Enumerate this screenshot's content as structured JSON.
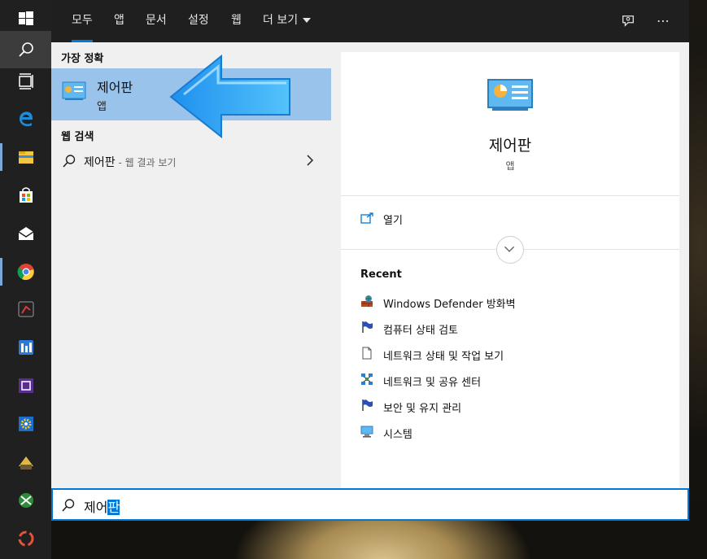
{
  "panel": {
    "tabs": [
      {
        "label": "모두",
        "active": true
      },
      {
        "label": "앱"
      },
      {
        "label": "문서"
      },
      {
        "label": "설정"
      },
      {
        "label": "웹"
      },
      {
        "label": "더 보기"
      }
    ],
    "feedback_icon": "feedback-icon",
    "more_options": "⋯"
  },
  "results": {
    "best_match_header": "가장 정확",
    "best_match": {
      "name": "제어판",
      "type": "앱",
      "icon": "control-panel-icon"
    },
    "web_header": "웹 검색",
    "web_query": "제어판",
    "web_suffix": " - 웹 결과 보기"
  },
  "detail": {
    "name": "제어판",
    "type": "앱",
    "open_label": "열기",
    "recent_header": "Recent",
    "recent": [
      {
        "label": "Windows Defender 방화벽",
        "icon": "firewall-icon"
      },
      {
        "label": "컴퓨터 상태 검토",
        "icon": "flag-icon"
      },
      {
        "label": "네트워크 상태 및 작업 보기",
        "icon": "document-icon"
      },
      {
        "label": "네트워크 및 공유 센터",
        "icon": "network-icon"
      },
      {
        "label": "보안 및 유지 관리",
        "icon": "flag-icon"
      },
      {
        "label": "시스템",
        "icon": "system-icon"
      }
    ]
  },
  "search": {
    "typed": "제어",
    "selected": "판"
  },
  "taskbar": {
    "items": [
      "windows-start-icon",
      "search-icon",
      "task-view-icon",
      "edge-icon",
      "file-explorer-icon",
      "store-icon",
      "mail-icon",
      "chrome-icon",
      "app-icon",
      "app-icon",
      "app-icon",
      "settings-icon",
      "app-icon",
      "app-icon",
      "app-icon"
    ]
  },
  "colors": {
    "accent": "#0078d7",
    "selection": "#99c3ea",
    "topbar": "#1f1f1f",
    "taskbar": "#202020"
  }
}
